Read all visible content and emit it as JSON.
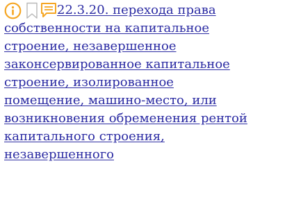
{
  "icons": {
    "info": "info-circle-icon",
    "bookmark": "bookmark-icon",
    "comment": "comment-icon",
    "info_color": "#f5a623",
    "bookmark_color": "#b8b8b8",
    "comment_color": "#f5a623"
  },
  "entry": {
    "link_color": "#2b2ba3",
    "lines": [
      "22.3.20. перехода права",
      "собственности на капитальное",
      "строение, незавершенное",
      "законсервированное капитальное",
      "строение, изолированное",
      "помещение, машино-место, или",
      "возникновения обременения рентой",
      "капитального строения,",
      "незавершенного"
    ]
  }
}
